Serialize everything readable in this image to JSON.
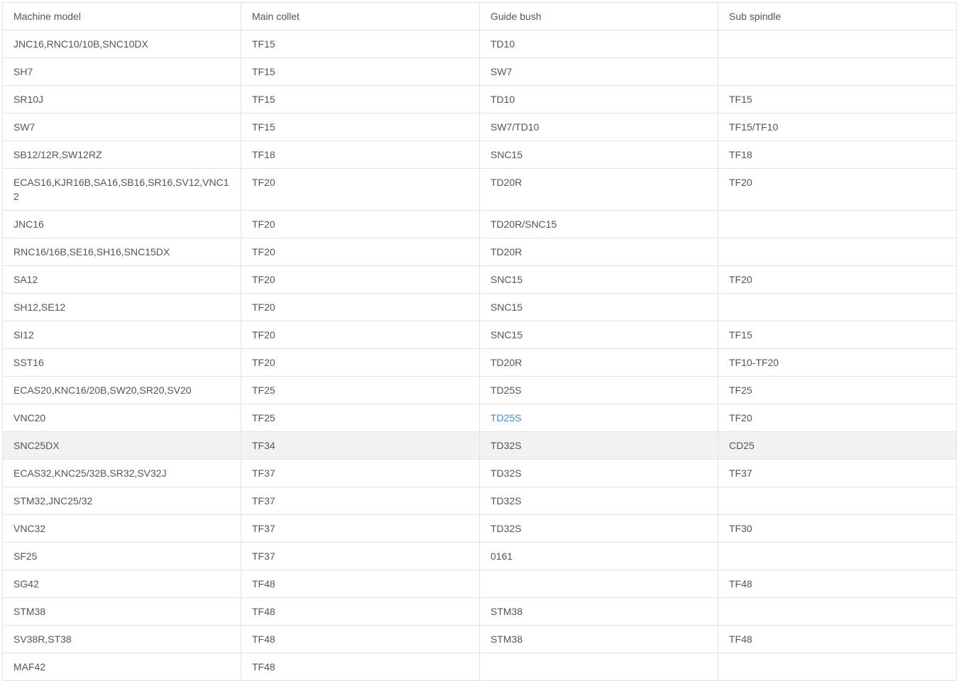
{
  "table": {
    "headers": [
      "Machine model",
      "Main collet",
      "Guide bush",
      "Sub spindle"
    ],
    "rows": [
      [
        "JNC16,RNC10/10B,SNC10DX",
        "TF15",
        "TD10",
        ""
      ],
      [
        "SH7",
        "TF15",
        "SW7",
        ""
      ],
      [
        "SR10J",
        "TF15",
        "TD10",
        "TF15"
      ],
      [
        "SW7",
        "TF15",
        "SW7/TD10",
        "TF15/TF10"
      ],
      [
        "SB12/12R,SW12RZ",
        "TF18",
        "SNC15",
        "TF18"
      ],
      [
        "ECAS16,KJR16B,SA16,SB16,SR16,SV12,VNC12",
        "TF20",
        "TD20R",
        "TF20"
      ],
      [
        "JNC16",
        "TF20",
        "TD20R/SNC15",
        ""
      ],
      [
        "RNC16/16B,SE16,SH16,SNC15DX",
        "TF20",
        "TD20R",
        ""
      ],
      [
        "SA12",
        "TF20",
        "SNC15",
        "TF20"
      ],
      [
        "SH12,SE12",
        "TF20",
        "SNC15",
        ""
      ],
      [
        "SI12",
        "TF20",
        "SNC15",
        "TF15"
      ],
      [
        "SST16",
        "TF20",
        "TD20R",
        "TF10-TF20"
      ],
      [
        "ECAS20,KNC16/20B,SW20,SR20,SV20",
        "TF25",
        "TD25S",
        "TF25"
      ],
      [
        "VNC20",
        "TF25",
        "TD25S",
        "TF20"
      ],
      [
        "SNC25DX",
        "TF34",
        "TD32S",
        "CD25"
      ],
      [
        "ECAS32,KNC25/32B,SR32,SV32J",
        "TF37",
        "TD32S",
        "TF37"
      ],
      [
        "STM32,JNC25/32",
        "TF37",
        "TD32S",
        ""
      ],
      [
        "VNC32",
        "TF37",
        "TD32S",
        "TF30"
      ],
      [
        "SF25",
        "TF37",
        "0161",
        ""
      ],
      [
        "SG42",
        "TF48",
        "",
        "TF48"
      ],
      [
        "STM38",
        "TF48",
        "STM38",
        ""
      ],
      [
        "SV38R,ST38",
        "TF48",
        "STM38",
        "TF48"
      ],
      [
        "MAF42",
        "TF48",
        "",
        ""
      ]
    ],
    "link_color": "#3a8ed4",
    "highlight_row_bg": "#f2f2f2"
  }
}
